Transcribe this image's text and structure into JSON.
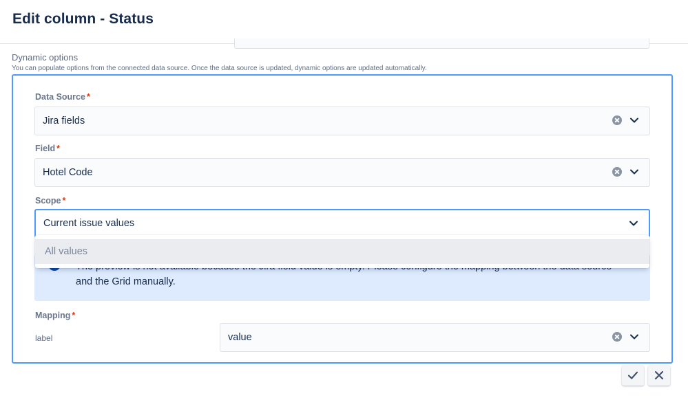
{
  "modal": {
    "title": "Edit column - Status"
  },
  "dynamic_options": {
    "title": "Dynamic options",
    "description": "You can populate options from the connected data source. Once the data source is updated, dynamic options are updated automatically."
  },
  "fields": {
    "data_source": {
      "label": "Data Source",
      "required_mark": "*",
      "value": "Jira fields",
      "icons": [
        "clear-icon",
        "chevron-down-icon"
      ]
    },
    "field": {
      "label": "Field",
      "required_mark": "*",
      "value": "Hotel Code",
      "icons": [
        "clear-icon",
        "chevron-down-icon"
      ]
    },
    "scope": {
      "label": "Scope",
      "required_mark": "*",
      "value": "Current issue values",
      "state": "open",
      "icons": [
        "chevron-down-icon"
      ]
    }
  },
  "scope_menu": {
    "options": [
      "All values"
    ]
  },
  "info": {
    "line1": "The preview is not available because the Jira field value is empty. Please configure the mapping between the data source",
    "line2": "and the Grid manually.",
    "icon": "info-icon"
  },
  "mapping": {
    "label": "Mapping",
    "required_mark": "*",
    "key": "label",
    "value": "value",
    "icons": [
      "clear-icon",
      "chevron-down-icon"
    ]
  },
  "actions": {
    "confirm_icon": "check-icon",
    "cancel_icon": "close-icon"
  },
  "colors": {
    "focus_border": "#4c9aff",
    "required": "#de350b",
    "info_background": "#deebff",
    "menu_option_hover": "#ebecf0"
  }
}
